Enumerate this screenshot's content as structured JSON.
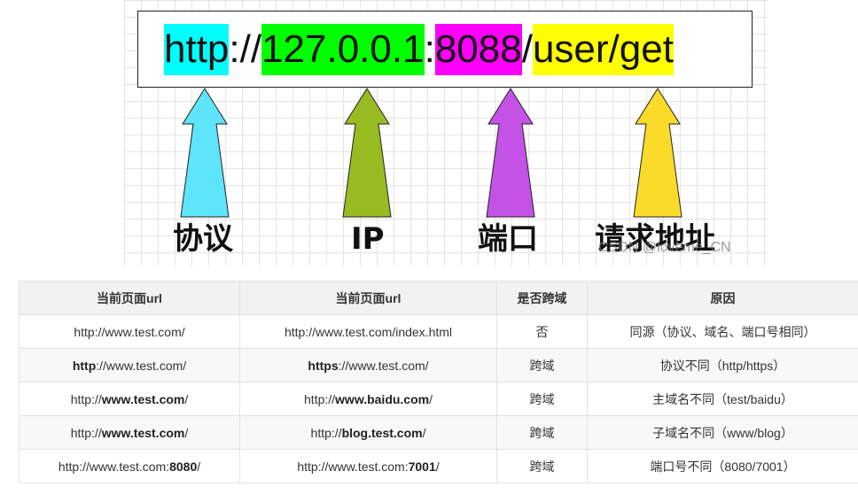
{
  "diagram": {
    "url_segments": {
      "protocol": "http",
      "sep1": "://",
      "ip": "127.0.0.1",
      "sep2": ":",
      "port": "8088",
      "sep3": "/",
      "path": "user/get"
    },
    "labels": {
      "protocol": "协议",
      "ip": "IP",
      "port": "端口",
      "path": "请求地址"
    },
    "arrow_colors": {
      "protocol": "#5ee4fb",
      "ip": "#99bb22",
      "port": "#c452e6",
      "path": "#fbdb2a"
    },
    "highlight_colors": {
      "protocol": "#00ffff",
      "ip": "#00ff00",
      "port": "#ff00ff",
      "path": "#ffff00"
    },
    "watermark": "CSDN @loveme_CN"
  },
  "table": {
    "headers": [
      "当前页面url",
      "当前页面url",
      "是否跨域",
      "原因"
    ],
    "rows": [
      {
        "url1": [
          {
            "t": "http://www.test.com/",
            "b": false
          }
        ],
        "url2": [
          {
            "t": "http://www.test.com/index.html",
            "b": false
          }
        ],
        "cross": "否",
        "reason": "同源（协议、域名、端口号相同）"
      },
      {
        "url1": [
          {
            "t": "http",
            "b": true
          },
          {
            "t": "://www.test.com/",
            "b": false
          }
        ],
        "url2": [
          {
            "t": "https",
            "b": true
          },
          {
            "t": "://www.test.com/",
            "b": false
          }
        ],
        "cross": "跨域",
        "reason": "协议不同（http/https）"
      },
      {
        "url1": [
          {
            "t": "http://",
            "b": false
          },
          {
            "t": "www.test.com",
            "b": true
          },
          {
            "t": "/",
            "b": false
          }
        ],
        "url2": [
          {
            "t": "http://",
            "b": false
          },
          {
            "t": "www.baidu.com",
            "b": true
          },
          {
            "t": "/",
            "b": false
          }
        ],
        "cross": "跨域",
        "reason": "主域名不同（test/baidu）"
      },
      {
        "url1": [
          {
            "t": "http://",
            "b": false
          },
          {
            "t": "www.test.com",
            "b": true
          },
          {
            "t": "/",
            "b": false
          }
        ],
        "url2": [
          {
            "t": "http://",
            "b": false
          },
          {
            "t": "blog.test.com",
            "b": true
          },
          {
            "t": "/",
            "b": false
          }
        ],
        "cross": "跨域",
        "reason": "子域名不同（www/blog）"
      },
      {
        "url1": [
          {
            "t": "http://www.test.com:",
            "b": false
          },
          {
            "t": "8080",
            "b": true
          },
          {
            "t": "/",
            "b": false
          }
        ],
        "url2": [
          {
            "t": "http://www.test.com:",
            "b": false
          },
          {
            "t": "7001",
            "b": true
          },
          {
            "t": "/",
            "b": false
          }
        ],
        "cross": "跨域",
        "reason": "端口号不同（8080/7001）"
      }
    ]
  }
}
